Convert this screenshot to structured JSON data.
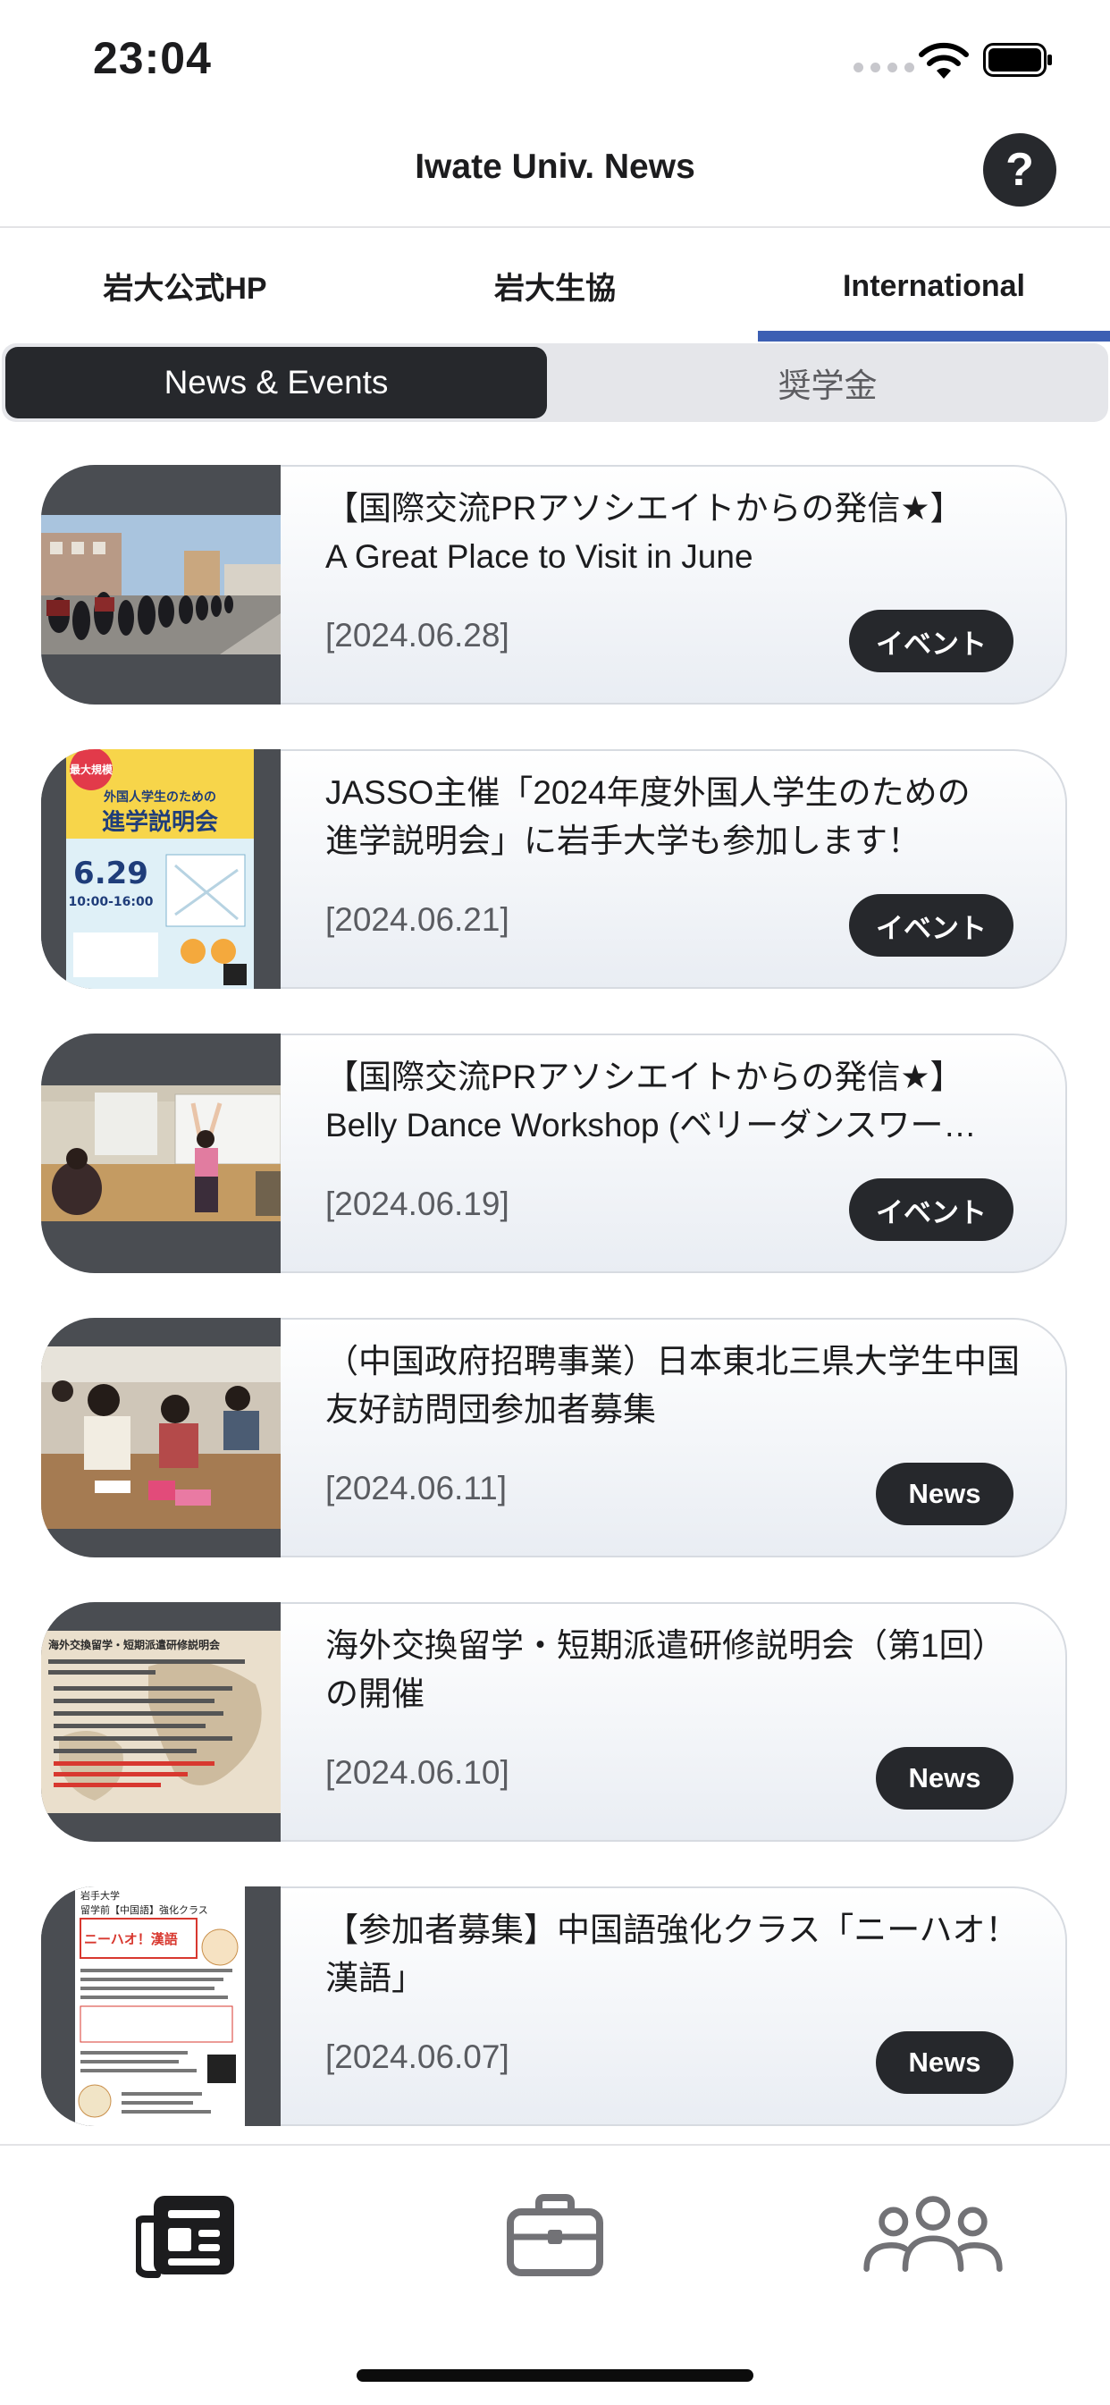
{
  "status_bar": {
    "time": "23:04"
  },
  "nav": {
    "title": "Iwate Univ. News",
    "help_label": "?"
  },
  "top_tabs": [
    {
      "label": "岩大公式HP",
      "selected": false
    },
    {
      "label": "岩大生協",
      "selected": false
    },
    {
      "label": "International",
      "selected": true
    }
  ],
  "segments": [
    {
      "label": "News & Events",
      "selected": true
    },
    {
      "label": "奨学金",
      "selected": false
    }
  ],
  "news": [
    {
      "title_lines": [
        "【国際交流PRアソシエイトからの発信★】",
        "A Great Place to Visit in June"
      ],
      "date": "[2024.06.28]",
      "tag": "イベント"
    },
    {
      "title_lines": [
        "JASSO主催「2024年度外国人学生のための",
        "進学説明会」に岩手大学も参加します！"
      ],
      "date": "[2024.06.21]",
      "tag": "イベント"
    },
    {
      "title_lines": [
        "【国際交流PRアソシエイトからの発信★】",
        "Belly Dance Workshop (ベリーダンスワー…"
      ],
      "date": "[2024.06.19]",
      "tag": "イベント"
    },
    {
      "title_lines": [
        "（中国政府招聘事業）日本東北三県大学生中国",
        "友好訪問団参加者募集"
      ],
      "date": "[2024.06.11]",
      "tag": "News"
    },
    {
      "title_lines": [
        "海外交換留学・短期派遣研修説明会（第1回）",
        "の開催"
      ],
      "date": "[2024.06.10]",
      "tag": "News"
    },
    {
      "title_lines": [
        "【参加者募集】中国語強化クラス「ニーハオ！",
        "漢語」"
      ],
      "date": "[2024.06.07]",
      "tag": "News"
    }
  ],
  "thumb_text": {
    "poster2_tag": "最大規模",
    "poster2_heading": "外国人学生のための",
    "poster2_title": "進学説明会",
    "poster2_date": "6.29",
    "poster2_time": "10:00-16:00",
    "poster5_title": "海外交換留学・短期派遣研修説明会",
    "poster6_org": "岩手大学",
    "poster6_title": "留学前【中国語】強化クラス",
    "poster6_sub": "ニーハオ！漢語"
  },
  "bottom_tabs": [
    {
      "icon": "newspaper-icon",
      "selected": true
    },
    {
      "icon": "briefcase-icon",
      "selected": false
    },
    {
      "icon": "people-icon",
      "selected": false
    }
  ],
  "colors": {
    "accent": "#3c5fb3",
    "dark": "#26282c",
    "card_border": "#d7dbe1"
  }
}
